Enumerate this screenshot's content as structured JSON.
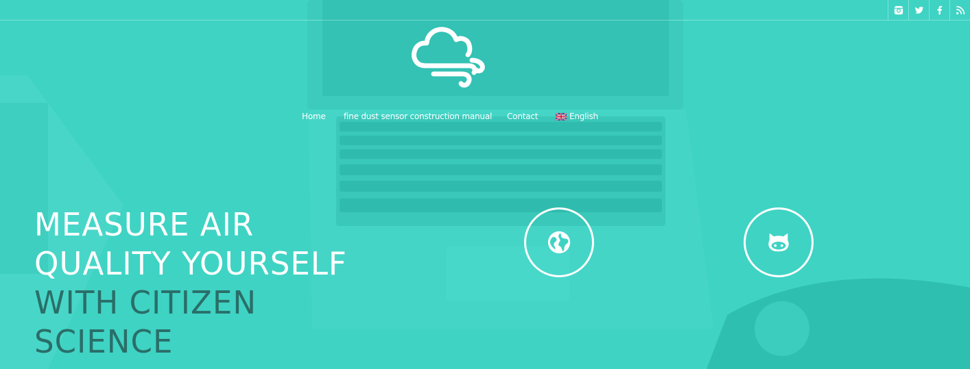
{
  "header": {
    "social": [
      {
        "icon": "instagram-icon"
      },
      {
        "icon": "twitter-icon"
      },
      {
        "icon": "facebook-icon"
      },
      {
        "icon": "rss-icon"
      }
    ],
    "logo_icon": "cloud-wind-icon"
  },
  "nav": {
    "home": "Home",
    "manual": "fine dust sensor construction manual",
    "contact": "Contact",
    "language": "English",
    "language_flag_icon": "uk-flag-icon"
  },
  "hero": {
    "line1": "MEASURE AIR",
    "line2": "QUALITY YOURSELF",
    "line3": "WITH CITIZEN",
    "line4": "SCIENCE",
    "buttons": [
      {
        "icon": "globe-icon"
      },
      {
        "icon": "github-icon"
      }
    ]
  },
  "colors": {
    "background": "#3fd3c4",
    "text_light": "#ffffff",
    "text_dark": "#2a6e68"
  }
}
